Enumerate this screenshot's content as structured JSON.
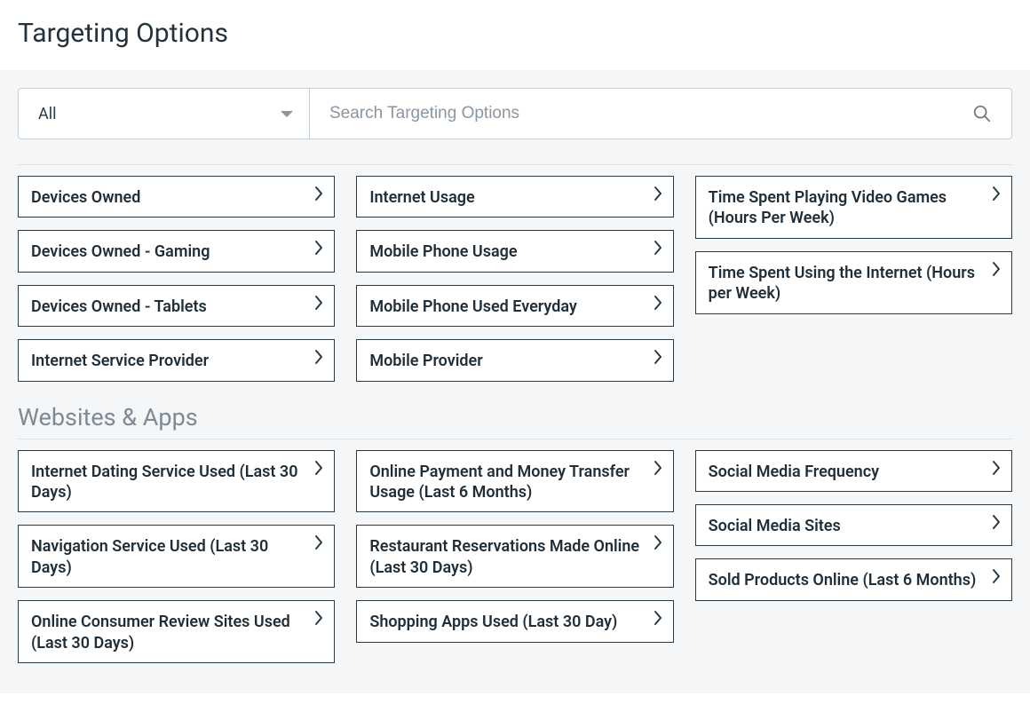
{
  "title": "Targeting Options",
  "filter": {
    "dropdown_value": "All",
    "search_placeholder": "Search Targeting Options"
  },
  "sections": [
    {
      "name": null,
      "columns": [
        [
          "Devices Owned",
          "Devices Owned - Gaming",
          "Devices Owned - Tablets",
          "Internet Service Provider"
        ],
        [
          "Internet Usage",
          "Mobile Phone Usage",
          "Mobile Phone Used Everyday",
          "Mobile Provider"
        ],
        [
          "Time Spent Playing Video Games (Hours Per Week)",
          "Time Spent Using the Internet (Hours per Week)"
        ]
      ]
    },
    {
      "name": "Websites & Apps",
      "columns": [
        [
          "Internet Dating Service Used (Last 30 Days)",
          "Navigation Service Used (Last 30 Days)",
          "Online Consumer Review Sites Used (Last 30 Days)"
        ],
        [
          "Online Payment and Money Transfer Usage (Last 6 Months)",
          "Restaurant Reservations Made Online (Last 30 Days)",
          "Shopping Apps Used (Last 30 Day)"
        ],
        [
          "Social Media Frequency",
          "Social Media Sites",
          "Sold Products Online (Last 6 Months)"
        ]
      ]
    }
  ]
}
